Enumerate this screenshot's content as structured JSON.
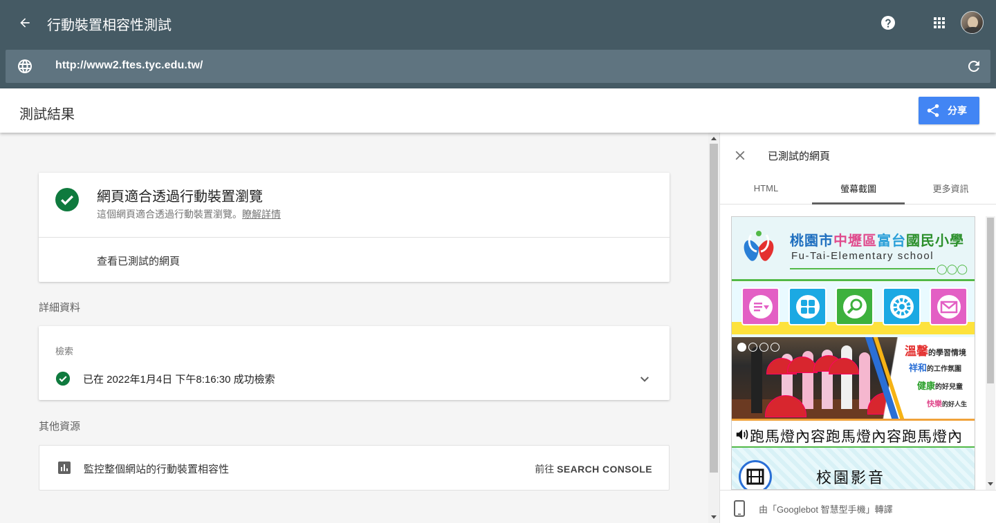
{
  "app": {
    "title": "行動裝置相容性測試",
    "url": "http://www2.ftes.tyc.edu.tw/"
  },
  "header": {
    "title": "測試結果",
    "share_label": "分享"
  },
  "result": {
    "title": "網頁適合透過行動裝置瀏覽",
    "subtitle": "這個網頁適合透過行動裝置瀏覽。",
    "learn_more": "瞭解詳情",
    "view_tested": "查看已測試的網頁"
  },
  "details": {
    "label": "詳細資料",
    "crawl_label": "檢索",
    "crawl_text": "已在 2022年1月4日 下午8:16:30 成功檢索"
  },
  "resources": {
    "label": "其他資源",
    "console_text": "監控整個網站的行動裝置相容性",
    "console_prefix": "前往",
    "console_link": "SEARCH CONSOLE"
  },
  "panel": {
    "title": "已測試的網頁",
    "tabs": [
      {
        "label": "HTML",
        "active": false
      },
      {
        "label": "螢幕截圖",
        "active": true
      },
      {
        "label": "更多資訊",
        "active": false
      }
    ],
    "footer": "由「Googlebot 智慧型手機」轉譯"
  },
  "preview": {
    "school_parts": [
      "桃園市",
      "中壢區",
      "富台",
      "國民小學"
    ],
    "school_en": "Fu-Tai-Elementary school",
    "slogan": [
      "溫馨",
      "的學習情境",
      "祥和",
      "的工作氛圍",
      "健康",
      "的好兒童",
      "快樂",
      "的好人生"
    ],
    "marquee": "跑馬燈內容跑馬燈內容跑馬燈內",
    "video_title": "校園影音"
  },
  "colors": {
    "appbar": "#455a64",
    "urlbar": "#5f7480",
    "accent": "#4285f4",
    "success": "#0f7a3e"
  },
  "icons": {
    "back": "arrow-left-icon",
    "help": "help-circle-icon",
    "apps": "apps-grid-icon",
    "globe": "globe-icon",
    "refresh": "refresh-icon",
    "share": "share-icon",
    "check": "check-circle-icon",
    "chevron": "chevron-down-icon",
    "bar_chart": "bar-chart-icon",
    "close": "close-icon",
    "phone": "smartphone-icon"
  }
}
